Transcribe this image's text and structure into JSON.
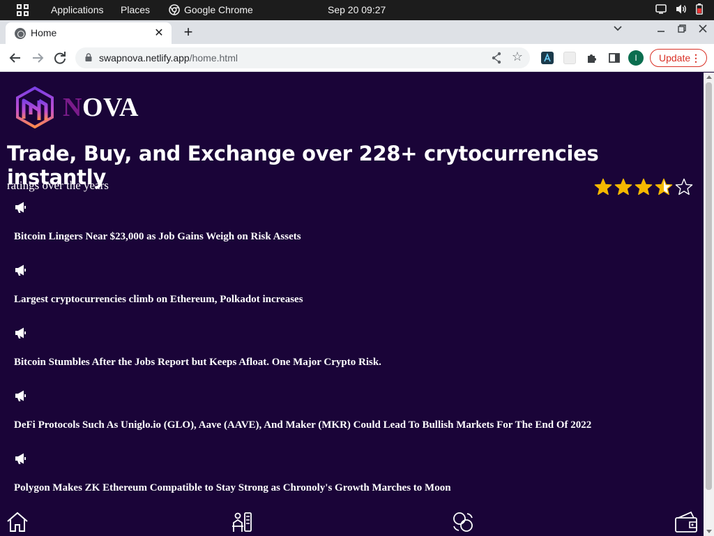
{
  "system_bar": {
    "applications": "Applications",
    "places": "Places",
    "browser": "Google Chrome",
    "clock": "Sep 20  09:27"
  },
  "browser": {
    "tab_title": "Home",
    "url_host": "swapnova.netlify.app",
    "url_path": "/home.html",
    "profile_initial": "I",
    "update_label": "Update"
  },
  "page": {
    "brand_first_letter": "N",
    "brand_rest": "OVA",
    "headline": "Trade, Buy, and Exchange over 228+ crytocurrencies instantly",
    "ratings_label": "ratings over the years",
    "rating": {
      "value": 3.5,
      "max": 5
    },
    "news": [
      "Bitcoin Lingers Near $23,000 as Job Gains Weigh on Risk Assets",
      "Largest cryptocurrencies climb on Ethereum, Polkadot increases",
      "Bitcoin Stumbles After the Jobs Report but Keeps Afloat. One Major Crypto Risk.",
      "DeFi Protocols Such As Uniglo.io (GLO), Aave (AAVE), And Maker (MKR) Could Lead To Bullish Markets For The End Of 2022",
      "Polygon Makes ZK Ethereum Compatible to Stay Strong as Chronoly's Growth Marches to Moon"
    ],
    "bottom_nav": [
      "home-icon",
      "trade-icon",
      "exchange-icon",
      "wallet-icon"
    ]
  },
  "colors": {
    "page_bg": "#1a0438",
    "star": "#f5b800",
    "brand_accent": "#7a1b8a"
  }
}
